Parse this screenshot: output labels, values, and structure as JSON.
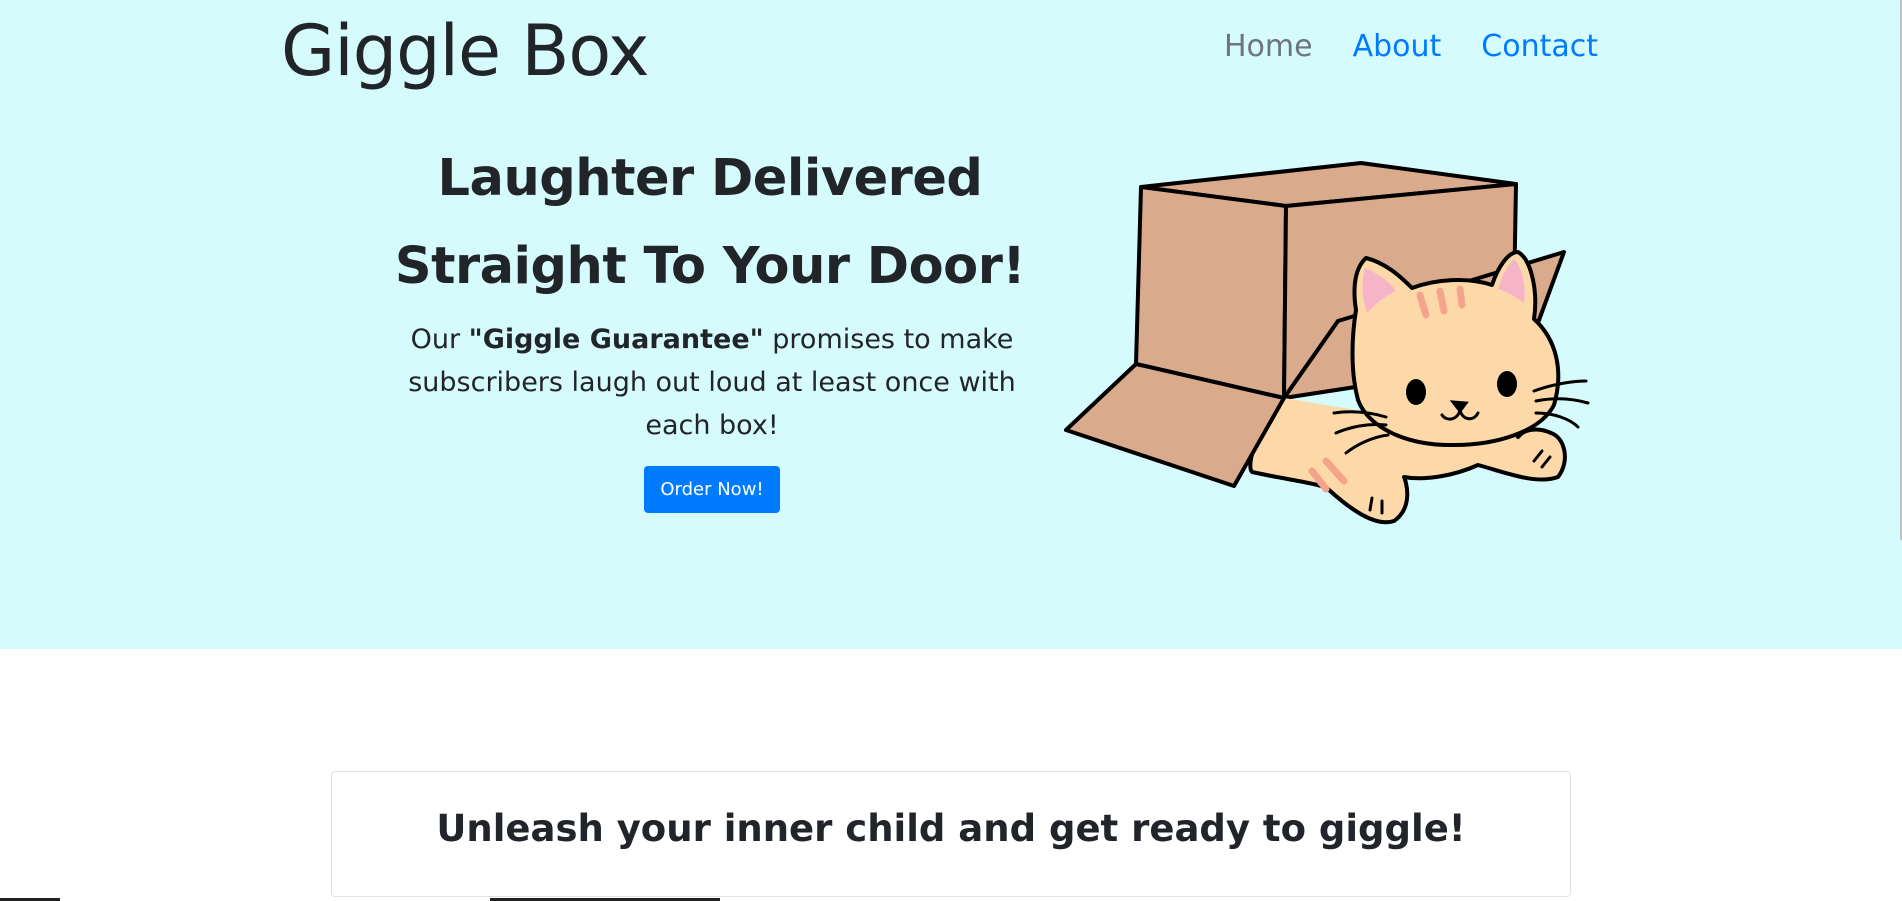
{
  "brand": "Giggle Box",
  "nav": {
    "home": "Home",
    "about": "About",
    "contact": "Contact"
  },
  "hero": {
    "headline_line1": "Laughter Delivered",
    "headline_line2": "Straight To Your Door!",
    "lead_prefix": "Our ",
    "lead_bold": "\"Giggle Guarantee\"",
    "lead_suffix": " promises to make subscribers laugh out loud at least once with each box!",
    "cta": "Order Now!",
    "illustration_icon": "cat-in-box-icon"
  },
  "card": {
    "title": "Unleash your inner child and get ready to giggle!"
  },
  "colors": {
    "hero_bg": "#d5fbfc",
    "primary": "#007bff",
    "nav_muted": "#6c757d",
    "box": "#d9ab8c",
    "cat": "#fdd9aa",
    "stripe": "#f4a48c",
    "ear": "#f6b4c8"
  }
}
